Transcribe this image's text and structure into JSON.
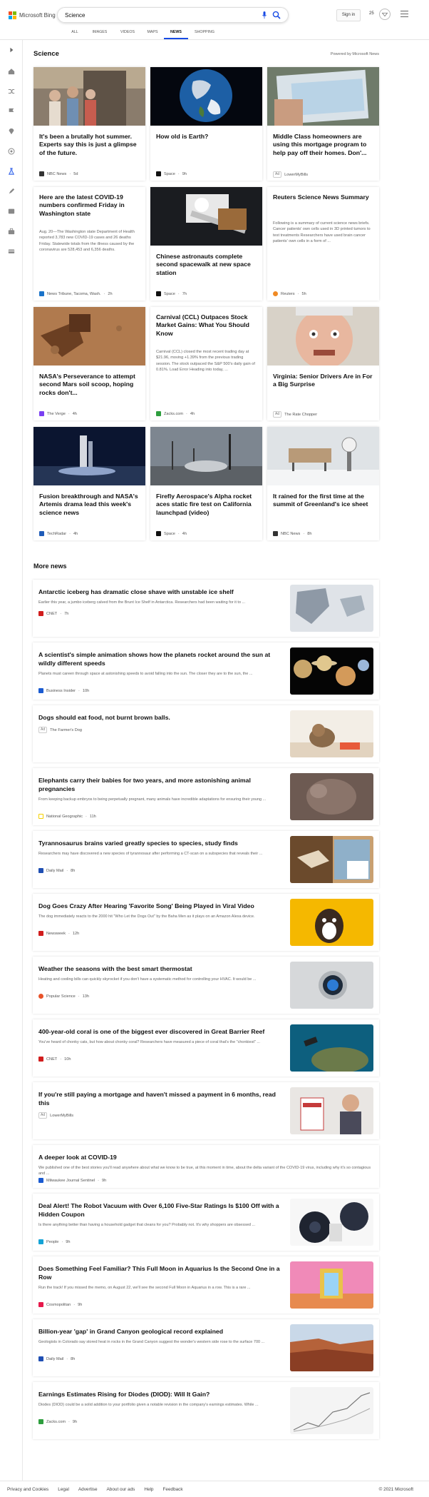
{
  "header": {
    "brand": "Microsoft Bing",
    "search_value": "Science",
    "signin_label": "Sign in",
    "points": "25",
    "tabs": [
      "ALL",
      "IMAGES",
      "VIDEOS",
      "MAPS",
      "NEWS",
      "SHOPPING"
    ],
    "active_tab": "NEWS"
  },
  "section": {
    "title": "Science",
    "powered": "Powered by Microsoft News"
  },
  "cards": [
    {
      "title": "It's been a brutally hot summer. Experts say this is just a glimpse of the future.",
      "summary": "",
      "source": "NBC News",
      "time": "5d",
      "ad": false,
      "icon": "nbc-icon",
      "color": "#333"
    },
    {
      "title": "How old is Earth?",
      "summary": "",
      "source": "Space",
      "time": "9h",
      "ad": false,
      "icon": "space-icon",
      "color": "#111"
    },
    {
      "title": "Middle Class homeowners are using this mortgage program to help pay off their homes. Don'...",
      "summary": "",
      "source": "LowerMyBills",
      "time": "",
      "ad": true,
      "icon": "",
      "color": ""
    },
    {
      "title": "Here are the latest COVID-19 numbers confirmed Friday in Washington state",
      "summary": "Aug. 20—The Washington state Department of Health reported 3,783 new COVID-19 cases and 26 deaths Friday. Statewide totals from the illness caused by the coronavirus are 528,453 and 6,356 deaths.",
      "source": "News Tribune, Tacoma, Wash.",
      "time": "2h",
      "ad": false,
      "icon": "news-tribune-icon",
      "color": "#1a73c9"
    },
    {
      "title": "Chinese astronauts complete second spacewalk at new space station",
      "summary": "",
      "source": "Space",
      "time": "7h",
      "ad": false,
      "icon": "space-icon",
      "color": "#111"
    },
    {
      "title": "Reuters Science News Summary",
      "summary": "Following is a summary of current science news briefs. Cancer patients' own cells used in 3D printed tumors to test treatments Researchers have used brain cancer patients' own cells in a form of ...",
      "source": "Reuters",
      "time": "5h",
      "ad": false,
      "icon": "reuters-icon",
      "color": "#f08a24"
    },
    {
      "title": "NASA's Perseverance to attempt second Mars soil scoop, hoping rocks don't...",
      "summary": "",
      "source": "The Verge",
      "time": "4h",
      "ad": false,
      "icon": "verge-icon",
      "color": "#7a3ff2"
    },
    {
      "title": "Carnival (CCL) Outpaces Stock Market Gains: What You Should Know",
      "summary": "Carnival (CCL) closed the most recent trading day at $21.96, moving +1.39% from the previous trading session. The stock outpaced the S&P 500's daily gain of 0.81%. Load Error Heading into today, ...",
      "source": "Zacks.com",
      "time": "4h",
      "ad": false,
      "icon": "zacks-icon",
      "color": "#2e9e3e"
    },
    {
      "title": "Virginia: Senior Drivers Are in For a Big Surprise",
      "summary": "",
      "source": "The Rate Chopper",
      "time": "",
      "ad": true,
      "icon": "",
      "color": ""
    },
    {
      "title": "Fusion breakthrough and NASA's Artemis drama lead this week's science news",
      "summary": "",
      "source": "TechRadar",
      "time": "4h",
      "ad": false,
      "icon": "techradar-icon",
      "color": "#1e5bb8"
    },
    {
      "title": "Firefly Aerospace's Alpha rocket aces static fire test on California launchpad (video)",
      "summary": "",
      "source": "Space",
      "time": "4h",
      "ad": false,
      "icon": "space-icon",
      "color": "#111"
    },
    {
      "title": "It rained for the first time at the summit of Greenland's ice sheet",
      "summary": "",
      "source": "NBC News",
      "time": "8h",
      "ad": false,
      "icon": "nbc-icon",
      "color": "#333"
    }
  ],
  "more": {
    "title": "More news",
    "items": [
      {
        "title": "Antarctic iceberg has dramatic close shave with unstable ice shelf",
        "desc": "Earlier this year, a jumbo iceberg calved from the Brunt Ice Shelf in Antarctica. Researchers had been waiting for it to ...",
        "source": "CNET",
        "time": "7h",
        "ad": false,
        "color": "#d11d1d"
      },
      {
        "title": "A scientist's simple animation shows how the planets rocket around the sun at wildly different speeds",
        "desc": "Planets must careen through space at astonishing speeds to avoid falling into the sun. The closer they are to the sun, the ...",
        "source": "Business Insider",
        "time": "10h",
        "ad": false,
        "color": "#1a5bd1"
      },
      {
        "title": "Dogs should eat food, not burnt brown balls.",
        "desc": "",
        "source": "The Farmer's Dog",
        "time": "",
        "ad": true,
        "color": ""
      },
      {
        "title": "Elephants carry their babies for two years, and more astonishing animal pregnancies",
        "desc": "From keeping backup embryos to being perpetually pregnant, many animals have incredible adaptations for ensuring their young ...",
        "source": "National Geographic",
        "time": "11h",
        "ad": false,
        "color": "#f5d000"
      },
      {
        "title": "Tyrannosaurus brains varied greatly species to species, study finds",
        "desc": "Researchers may have discovered a new species of tyrannosaur after performing a CT-scan on a subspecies that reveals their ...",
        "source": "Daily Mail",
        "time": "8h",
        "ad": false,
        "color": "#1f4fb3"
      },
      {
        "title": "Dog Goes Crazy After Hearing 'Favorite Song' Being Played in Viral Video",
        "desc": "The dog immediately reacts to the 2000 hit \"Who Let the Dogs Out\" by the Baha Men as it plays on an Amazon Alexa device.",
        "source": "Newsweek",
        "time": "12h",
        "ad": false,
        "color": "#d11d1d"
      },
      {
        "title": "Weather the seasons with the best smart thermostat",
        "desc": "Heating and cooling bills can quickly skyrocket if you don't have a systematic method for controlling your HVAC. It would be ...",
        "source": "Popular Science",
        "time": "13h",
        "ad": false,
        "color": "#e8532a"
      },
      {
        "title": "400-year-old coral is one of the biggest ever discovered in Great Barrier Reef",
        "desc": "You've heard of chonky cats, but how about chonky coral? Researchers have measured a piece of coral that's the \"chonkiest\" ...",
        "source": "CNET",
        "time": "10h",
        "ad": false,
        "color": "#d11d1d"
      },
      {
        "title": "If you're still paying a mortgage and haven't missed a payment in 6 months, read this",
        "desc": "",
        "source": "LowerMyBills",
        "time": "",
        "ad": true,
        "color": ""
      },
      {
        "title": "A deeper look at COVID-19",
        "desc": "We published one of the best stories you'll read anywhere about what we know to be true, at this moment in time, about the delta variant of the COVID-19 virus, including why it's so contagious and ...",
        "source": "Milwaukee Journal Sentinel",
        "time": "9h",
        "ad": false,
        "color": "#1a5bd1"
      },
      {
        "title": "Deal Alert! The Robot Vacuum with Over 6,100 Five-Star Ratings Is $100 Off with a Hidden Coupon",
        "desc": "Is there anything better than having a household gadget that cleans for you? Probably not. It's why shoppers are obsessed ...",
        "source": "People",
        "time": "9h",
        "ad": false,
        "color": "#14a3d6"
      },
      {
        "title": "Does Something Feel Familiar? This Full Moon in Aquarius Is the Second One in a Row",
        "desc": "Run the track! If you missed the memo, on August 22, we'll see the second Full Moon in Aquarius in a row. This is a rare ...",
        "source": "Cosmopolitan",
        "time": "9h",
        "ad": false,
        "color": "#e6194b"
      },
      {
        "title": "Billion-year 'gap' in Grand Canyon geological record explained",
        "desc": "Geologists in Colorado say stored heat in rocks in the Grand Canyon suggest the wonder's western side rose to the surface 700 ...",
        "source": "Daily Mail",
        "time": "8h",
        "ad": false,
        "color": "#1f4fb3"
      },
      {
        "title": "Earnings Estimates Rising for Diodes (DIOD): Will It Gain?",
        "desc": "Diodes (DIOD) could be a solid addition to your portfolio given a notable revision in the company's earnings estimates. While ...",
        "source": "Zacks.com",
        "time": "9h",
        "ad": false,
        "color": "#2e9e3e"
      }
    ]
  },
  "footer": {
    "links": [
      "Privacy and Cookies",
      "Legal",
      "Advertise",
      "About our ads",
      "Help",
      "Feedback"
    ],
    "copyright": "© 2021 Microsoft"
  },
  "ad_label": "Ad",
  "colors": {
    "accent": "#174ae4",
    "brand_red": "#f25022",
    "brand_green": "#7fba00",
    "brand_blue": "#00a4ef",
    "brand_yellow": "#ffb900"
  }
}
